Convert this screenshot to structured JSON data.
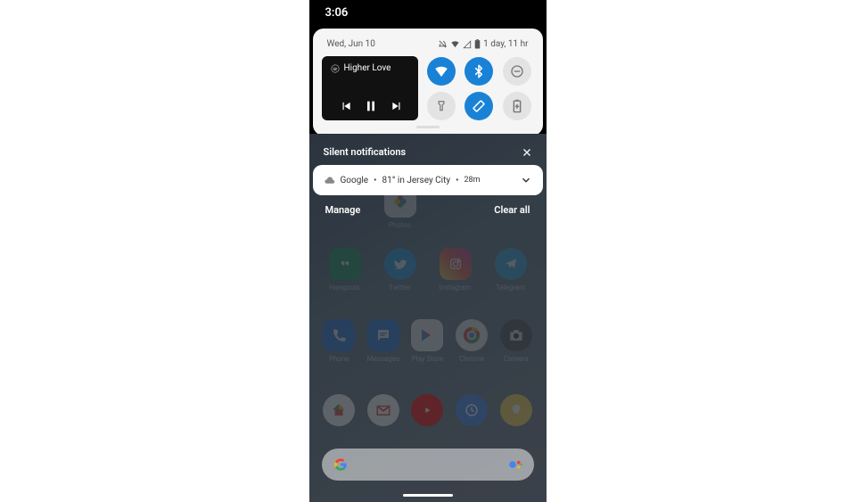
{
  "statusBar": {
    "time": "3:06"
  },
  "panel": {
    "date": "Wed, Jun 10",
    "battery": "1 day, 11 hr"
  },
  "media": {
    "title": "Higher Love"
  },
  "qs": [
    {
      "name": "wifi",
      "on": true
    },
    {
      "name": "bluetooth",
      "on": true
    },
    {
      "name": "dnd",
      "on": false
    },
    {
      "name": "flashlight",
      "on": false
    },
    {
      "name": "autorotate",
      "on": true
    },
    {
      "name": "battery-saver",
      "on": false
    }
  ],
  "silentHeader": "Silent notifications",
  "notification": {
    "app": "Google",
    "summary": "81° in Jersey City",
    "time": "28m"
  },
  "actions": {
    "manage": "Manage",
    "clearAll": "Clear all"
  },
  "apps": {
    "row1": [
      {
        "label": "Photos",
        "icon": "photos",
        "offset": 2
      }
    ],
    "row2": [
      {
        "label": "Hangouts",
        "icon": "hangouts"
      },
      {
        "label": "Twitter",
        "icon": "twitter"
      },
      {
        "label": "Instagram",
        "icon": "instagram"
      },
      {
        "label": "Telegram",
        "icon": "telegram"
      }
    ],
    "row3": [
      {
        "label": "Phone",
        "icon": "phone"
      },
      {
        "label": "Messages",
        "icon": "messages"
      },
      {
        "label": "Play Store",
        "icon": "playstore"
      },
      {
        "label": "Chrome",
        "icon": "chrome"
      },
      {
        "label": "Camera",
        "icon": "camera"
      }
    ],
    "row4": [
      {
        "label": "",
        "icon": "home"
      },
      {
        "label": "",
        "icon": "gmail"
      },
      {
        "label": "",
        "icon": "youtube"
      },
      {
        "label": "",
        "icon": "clock"
      },
      {
        "label": "",
        "icon": "bulb"
      }
    ]
  }
}
